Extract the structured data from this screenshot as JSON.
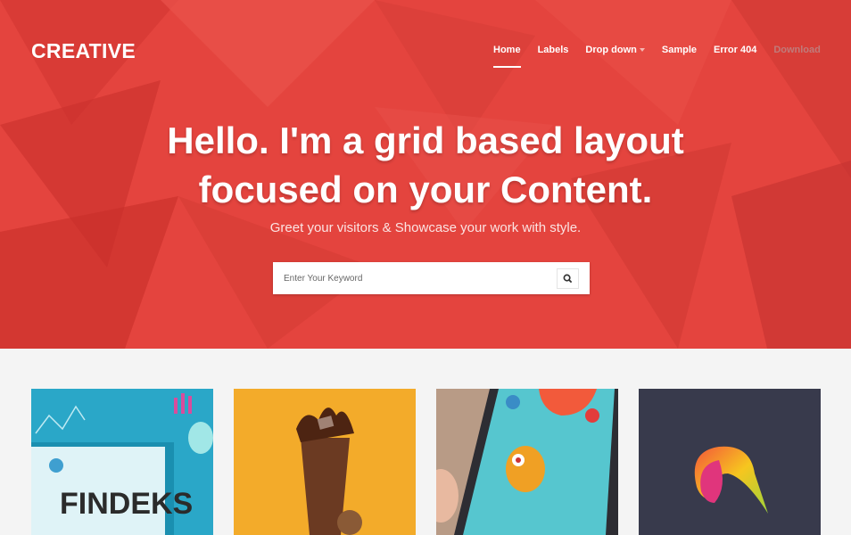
{
  "header": {
    "logo": "CREATIVE",
    "nav": [
      {
        "label": "Home",
        "active": true
      },
      {
        "label": "Labels"
      },
      {
        "label": "Drop down",
        "has_caret": true
      },
      {
        "label": "Sample"
      },
      {
        "label": "Error 404"
      },
      {
        "label": "Download",
        "disabled": true
      }
    ]
  },
  "hero": {
    "headline_line1": "Hello. I'm a grid based layout",
    "headline_line2": "focused on your Content.",
    "subline": "Greet your visitors & Showcase your work with style.",
    "search_placeholder": "Enter Your Keyword",
    "search_icon": "search-icon",
    "bg_color": "#e5423d"
  },
  "cards": [
    {
      "name": "findeks",
      "caption": "FINDEKS"
    },
    {
      "name": "chocolate-drink"
    },
    {
      "name": "mobile-game"
    },
    {
      "name": "color-logo"
    }
  ]
}
